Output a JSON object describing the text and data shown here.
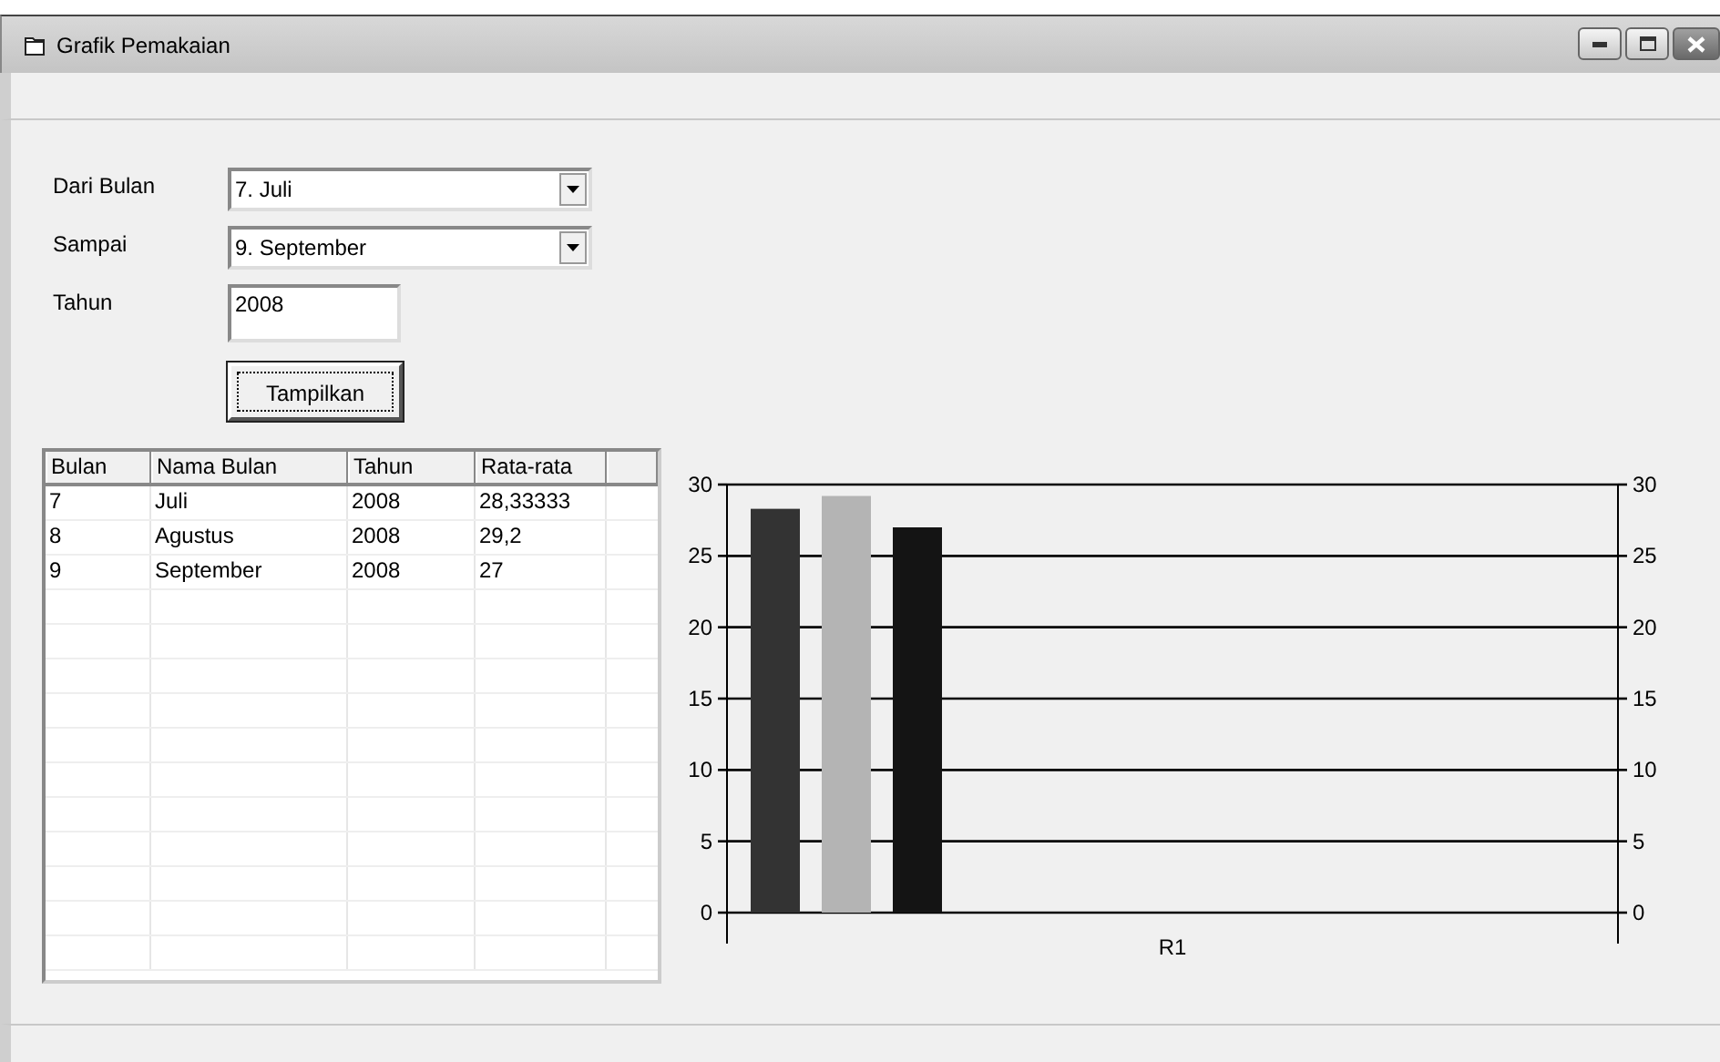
{
  "window": {
    "title": "Grafik Pemakaian"
  },
  "form": {
    "fields": [
      {
        "kind": "dropdown",
        "label": "Dari Bulan",
        "value": "7. Juli"
      },
      {
        "kind": "dropdown",
        "label": "Sampai",
        "value": "9. September"
      },
      {
        "kind": "text",
        "label": "Tahun",
        "value": "2008"
      }
    ],
    "button": {
      "label": "Tampilkan",
      "focused": true
    }
  },
  "table": {
    "columns": [
      "Bulan",
      "Nama Bulan",
      "Tahun",
      "Rata-rata"
    ],
    "rows": [
      [
        "7",
        "Juli",
        "2008",
        "28,33333"
      ],
      [
        "8",
        "Agustus",
        "2008",
        "29,2"
      ],
      [
        "9",
        "September",
        "2008",
        "27"
      ]
    ]
  },
  "chart": {
    "chart_data": {
      "type": "bar",
      "categories": [
        "R1"
      ],
      "series": [
        {
          "color": "#333333",
          "values": [
            28.3
          ]
        },
        {
          "color": "#b4b4b4",
          "values": [
            29.2
          ]
        },
        {
          "color": "#141414",
          "values": [
            27
          ]
        }
      ],
      "ylim": [
        0,
        30
      ],
      "yticks": [
        0,
        5,
        10,
        15,
        20,
        25,
        30
      ],
      "grid": true
    },
    "right_axis_labels": [
      "30",
      "25",
      "20",
      "15",
      "10",
      "5",
      "0"
    ]
  }
}
